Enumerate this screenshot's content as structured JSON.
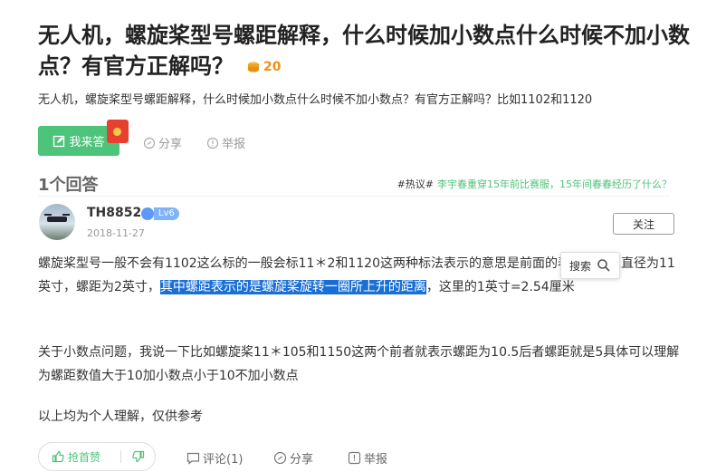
{
  "question": {
    "title": "无人机，螺旋桨型号螺距解释，什么时候加小数点什么时候不加小数点？有官方正解吗？",
    "reward": "20",
    "description": "无人机，螺旋桨型号螺距解释，什么时候加小数点什么时候不加小数点？有官方正解吗？比如1102和1120",
    "answer_button": "我来答",
    "share": "分享",
    "report": "举报"
  },
  "answers_header": {
    "count_label": "1个回答",
    "hot_tag": "#热议#",
    "hot_link": "李宇春重穿15年前比赛服，15年间春春经历了什么？"
  },
  "answer": {
    "username": "TH8852",
    "level": "Lv6",
    "date": "2018-11-27",
    "follow": "关注",
    "para1_before": "螺旋桨型号一般不会有1102这么标的一般会标11＊2和1120这两种标法表示的意思是前面的表示螺旋桨直径为11英寸，螺距为2英寸，",
    "para1_highlight": "其中螺距表示的是螺旋桨旋转一圈所上升的距离",
    "para1_after": "，这里的1英寸=2.54厘米",
    "para2": "关于小数点问题，我说一下比如螺旋桨11＊105和1150这两个前者就表示螺距为10.5后者螺距就是5具体可以理解为螺距数值大于10加小数点小于10不加小数点",
    "para3": "以上均为个人理解，仅供参考",
    "search_popup": "搜索",
    "like": "抢首赞",
    "comment": "评论(1)",
    "share": "分享",
    "report": "举报"
  },
  "colors": {
    "green": "#4ec37a",
    "highlight": "#1a6fd6",
    "coin": "#f08f10"
  }
}
